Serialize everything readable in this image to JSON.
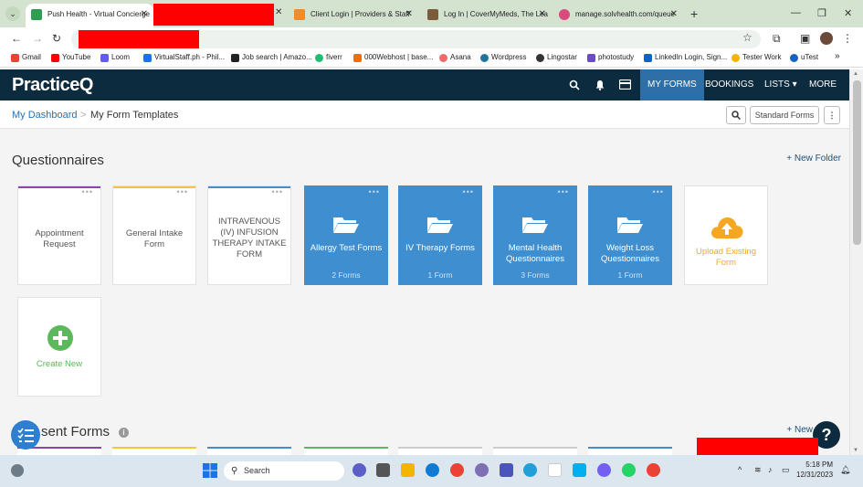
{
  "browser": {
    "tabs": [
      {
        "title": "Push Health - Virtual Concierge",
        "active": true,
        "favicon_color": "#2e9d4f"
      },
      {
        "title": "Client Login | Providers & Staff",
        "active": false,
        "favicon_color": "#f28c28"
      },
      {
        "title": "Log In | CoverMyMeds, The Lea",
        "active": false,
        "favicon_color": "#7a5c3a"
      },
      {
        "title": "manage.solvhealth.com/queue",
        "active": false,
        "favicon_color": "#d94b7c"
      }
    ],
    "new_tab_label": "+",
    "bookmarks": [
      {
        "label": "Gmail",
        "color": "#ea4335"
      },
      {
        "label": "YouTube",
        "color": "#ff0000"
      },
      {
        "label": "Loom",
        "color": "#625df5"
      },
      {
        "label": "VirtualStaff.ph - Phil...",
        "color": "#1a73e8"
      },
      {
        "label": "Job search | Amazo...",
        "color": "#222222"
      },
      {
        "label": "fiverr",
        "color": "#1dbf73"
      },
      {
        "label": "000Webhost | base...",
        "color": "#ff6a00"
      },
      {
        "label": "Asana",
        "color": "#f06a6a"
      },
      {
        "label": "Wordpress",
        "color": "#21759b"
      },
      {
        "label": "Lingostar",
        "color": "#333333"
      },
      {
        "label": "photostudy",
        "color": "#6c4cc4"
      },
      {
        "label": "LinkedIn Login, Sign...",
        "color": "#0a66c2"
      },
      {
        "label": "Tester Work",
        "color": "#f4b400"
      },
      {
        "label": "uTest",
        "color": "#1565c0"
      }
    ],
    "bookmarks_more": "»"
  },
  "app": {
    "logo_part1": "Practice",
    "logo_part2": "Q",
    "nav": {
      "my_forms": "MY FORMS",
      "bookings": "BOOKINGS",
      "lists": "LISTS ▾",
      "more": "MORE ▾"
    },
    "breadcrumb": {
      "root": "My Dashboard",
      "sep": ">",
      "current": "My Form Templates"
    },
    "standard_forms_label": "Standard Forms",
    "questionnaires_title": "Questionnaires",
    "new_folder_label": "+ New Folder",
    "cards": [
      {
        "title": "Appointment Request",
        "top_color": "#8e44ad"
      },
      {
        "title": "General Intake Form",
        "top_color": "#f5c242"
      },
      {
        "title": "INTRAVENOUS (IV) INFUSION THERAPY INTAKE FORM",
        "top_color": "#3e8ed0"
      }
    ],
    "folders": [
      {
        "title": "Allergy Test Forms",
        "count": "2 Forms"
      },
      {
        "title": "IV Therapy Forms",
        "count": "1 Form"
      },
      {
        "title": "Mental Health Questionnaires",
        "count": "3 Forms"
      },
      {
        "title": "Weight Loss Questionnaires",
        "count": "1 Form"
      }
    ],
    "upload_label": "Upload Existing Form",
    "create_new_label": "Create New",
    "recent_forms_title": "sent Forms",
    "recent_new_label": "+ New",
    "help_label": "?"
  },
  "taskbar": {
    "search_label": "Search",
    "time": "5:18 PM",
    "date": "12/31/2023"
  }
}
